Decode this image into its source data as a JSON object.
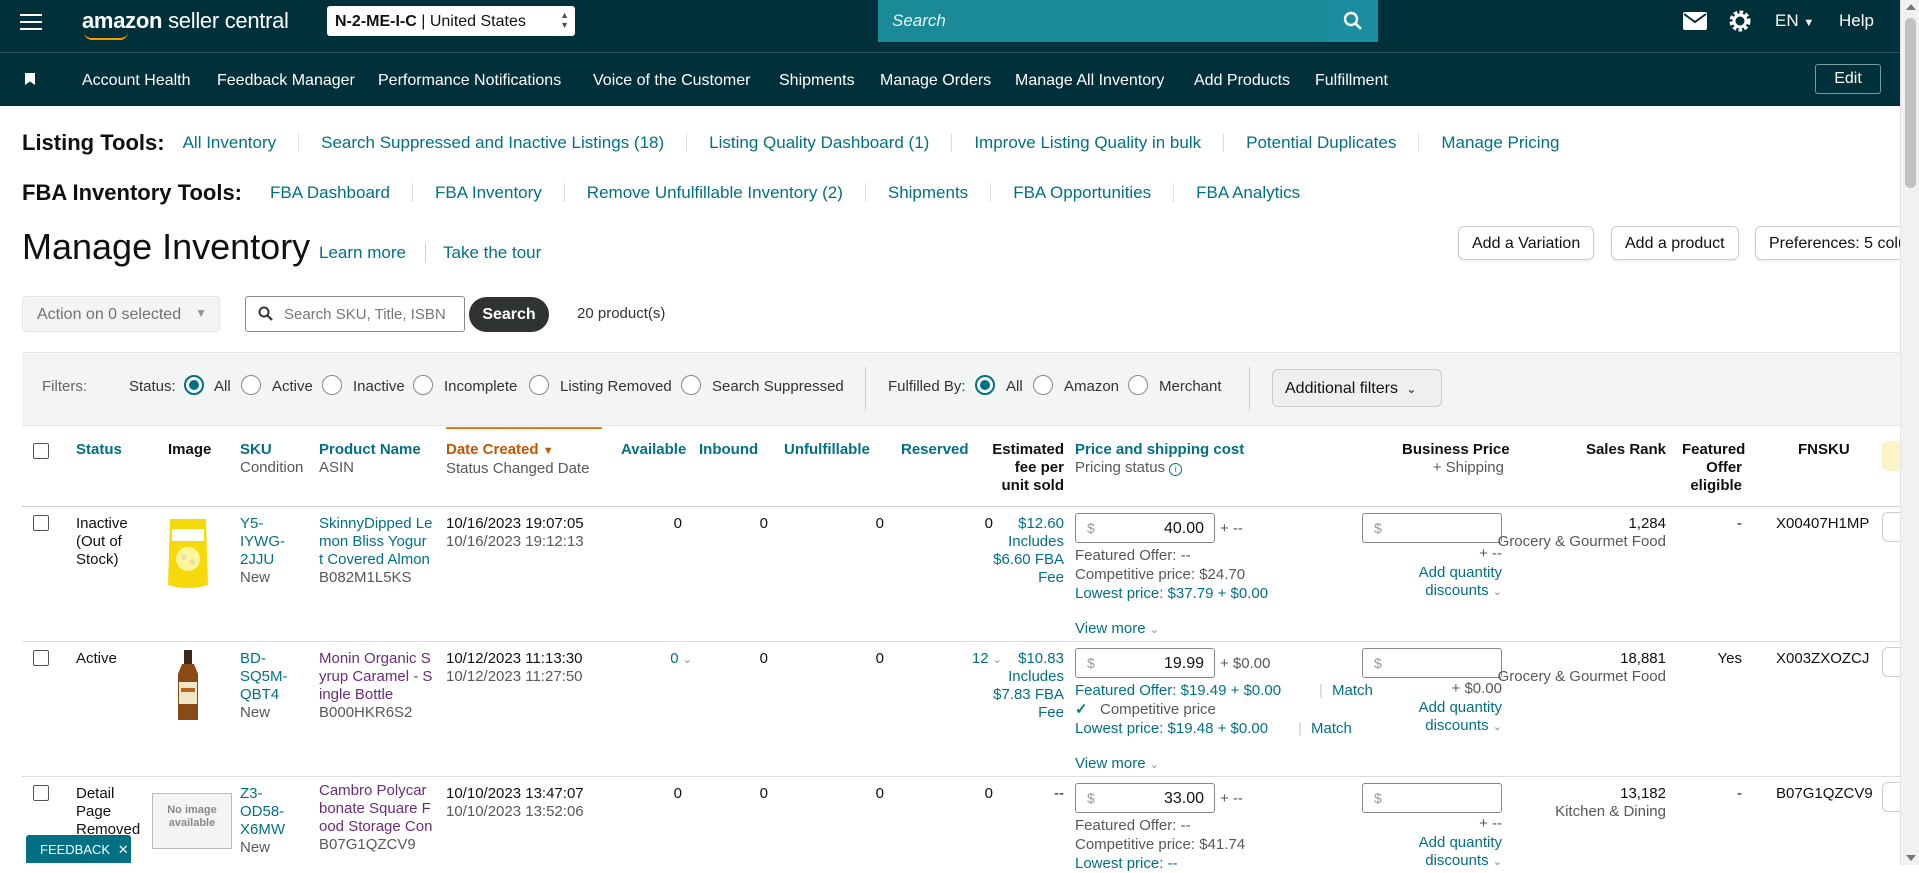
{
  "header": {
    "logo_amazon": "amazon",
    "logo_sc": "seller central",
    "account_store": "N-2-ME-I-C",
    "account_sep": " | ",
    "account_country": "United States",
    "search_placeholder": "Search",
    "lang": "EN",
    "help": "Help"
  },
  "nav": {
    "items": [
      "Account Health",
      "Feedback Manager",
      "Performance Notifications",
      "Voice of the Customer",
      "Shipments",
      "Manage Orders",
      "Manage All Inventory",
      "Add Products",
      "Fulfillment"
    ],
    "edit": "Edit"
  },
  "listing_tools": {
    "label": "Listing Tools:",
    "links": [
      "All Inventory",
      "Search Suppressed and Inactive Listings (18)",
      "Listing Quality Dashboard (1)",
      "Improve Listing Quality in bulk",
      "Potential Duplicates",
      "Manage Pricing"
    ]
  },
  "fba_tools": {
    "label": "FBA Inventory Tools:",
    "links": [
      "FBA Dashboard",
      "FBA Inventory",
      "Remove Unfulfillable Inventory (2)",
      "Shipments",
      "FBA Opportunities",
      "FBA Analytics"
    ]
  },
  "page": {
    "title": "Manage Inventory",
    "learn_more": "Learn more",
    "tour": "Take the tour",
    "add_variation": "Add a Variation",
    "add_product": "Add a product",
    "preferences": "Preferences: 5 colu"
  },
  "toolbar": {
    "action": "Action on 0 selected",
    "search_placeholder": "Search SKU, Title, ISBN",
    "search_btn": "Search",
    "count": "20 product(s)"
  },
  "filters": {
    "label": "Filters:",
    "status_label": "Status:",
    "status_opts": [
      "All",
      "Active",
      "Inactive",
      "Incomplete",
      "Listing Removed",
      "Search Suppressed"
    ],
    "status_selected": "All",
    "fulfilled_label": "Fulfilled By:",
    "fulfilled_opts": [
      "All",
      "Amazon",
      "Merchant"
    ],
    "fulfilled_selected": "All",
    "additional": "Additional filters"
  },
  "columns": {
    "status": "Status",
    "image": "Image",
    "sku": "SKU",
    "sku_sub": "Condition",
    "name": "Product Name",
    "name_sub": "ASIN",
    "date": "Date Created",
    "date_sub": "Status Changed Date",
    "available": "Available",
    "inbound": "Inbound",
    "unfulfillable": "Unfulfillable",
    "reserved": "Reserved",
    "fee1": "Estimated",
    "fee2": "fee per",
    "fee3": "unit sold",
    "price": "Price and shipping cost",
    "price_sub": "Pricing status",
    "bprice": "Business Price",
    "bprice_sub": "+ Shipping",
    "rank": "Sales Rank",
    "featured1": "Featured",
    "featured2": "Offer",
    "featured3": "eligible",
    "fnsku": "FNSKU"
  },
  "rows": [
    {
      "status1": "Inactive",
      "status2": "(Out of",
      "status3": "Stock)",
      "sku1": "Y5-",
      "sku2": "IYWG-",
      "sku3": "2JJU",
      "condition": "New",
      "name1": "SkinnyDipped Le",
      "name2": "mon Bliss Yogur",
      "name3": "t Covered Almon",
      "asin": "B082M1L5KS",
      "created": "10/16/2023 19:07:05",
      "changed": "10/16/2023 19:12:13",
      "available": "0",
      "inbound": "0",
      "unfulfillable": "0",
      "reserved": "0",
      "fee1": "$12.60",
      "fee2": "Includes",
      "fee3": "$6.60 FBA",
      "fee4": "Fee",
      "price": "40.00",
      "ship": "+ --",
      "featured_offer": "Featured Offer: --",
      "competitive": "Competitive price: $24.70",
      "lowest": "Lowest price: $37.79 + $0.00",
      "view_more": "View more",
      "bship": "+ --",
      "qty1": "Add quantity",
      "qty2": "discounts",
      "rank": "1,284",
      "category": "Grocery & Gourmet Food",
      "featured": "-",
      "fnsku": "X00407H1MP"
    },
    {
      "status1": "Active",
      "sku1": "BD-",
      "sku2": "SQ5M-",
      "sku3": "QBT4",
      "condition": "New",
      "name1": "Monin Organic S",
      "name2": "yrup Caramel - S",
      "name3": "ingle Bottle",
      "asin": "B000HKR6S2",
      "created": "10/12/2023 11:13:30",
      "changed": "10/12/2023 11:27:50",
      "available": "0",
      "inbound": "0",
      "unfulfillable": "0",
      "reserved": "12",
      "fee1": "$10.83",
      "fee2": "Includes",
      "fee3": "$7.83 FBA",
      "fee4": "Fee",
      "price": "19.99",
      "ship": "+ $0.00",
      "featured_offer": "Featured Offer: $19.49 + $0.00",
      "match": "Match",
      "competitive": "Competitive price",
      "lowest": "Lowest price: $19.48 + $0.00",
      "match2": "Match",
      "view_more": "View more",
      "bship": "+ $0.00",
      "qty1": "Add quantity",
      "qty2": "discounts",
      "rank": "18,881",
      "category": "Grocery & Gourmet Food",
      "featured": "Yes",
      "fnsku": "X003ZXOZCJ"
    },
    {
      "status1": "Detail",
      "status2": "Page",
      "status3": "Removed",
      "sku1": "Z3-",
      "sku2": "OD58-",
      "sku3": "X6MW",
      "condition": "New",
      "no_image1": "No image",
      "no_image2": "available",
      "name1": "Cambro Polycar",
      "name2": "bonate Square F",
      "name3": "ood Storage Con",
      "asin": "B07G1QZCV9",
      "created": "10/10/2023 13:47:07",
      "changed": "10/10/2023 13:52:06",
      "available": "0",
      "inbound": "0",
      "unfulfillable": "0",
      "reserved": "0",
      "fee1": "--",
      "price": "33.00",
      "ship": "+ --",
      "featured_offer": "Featured Offer: --",
      "competitive": "Competitive price: $41.74",
      "lowest": "Lowest price: --",
      "bship": "+ --",
      "qty1": "Add quantity",
      "qty2": "discounts",
      "rank": "13,182",
      "category": "Kitchen & Dining",
      "featured": "-",
      "fnsku": "B07G1QZCV9"
    }
  ],
  "currency": "$",
  "feedback": "FEEDBACK"
}
